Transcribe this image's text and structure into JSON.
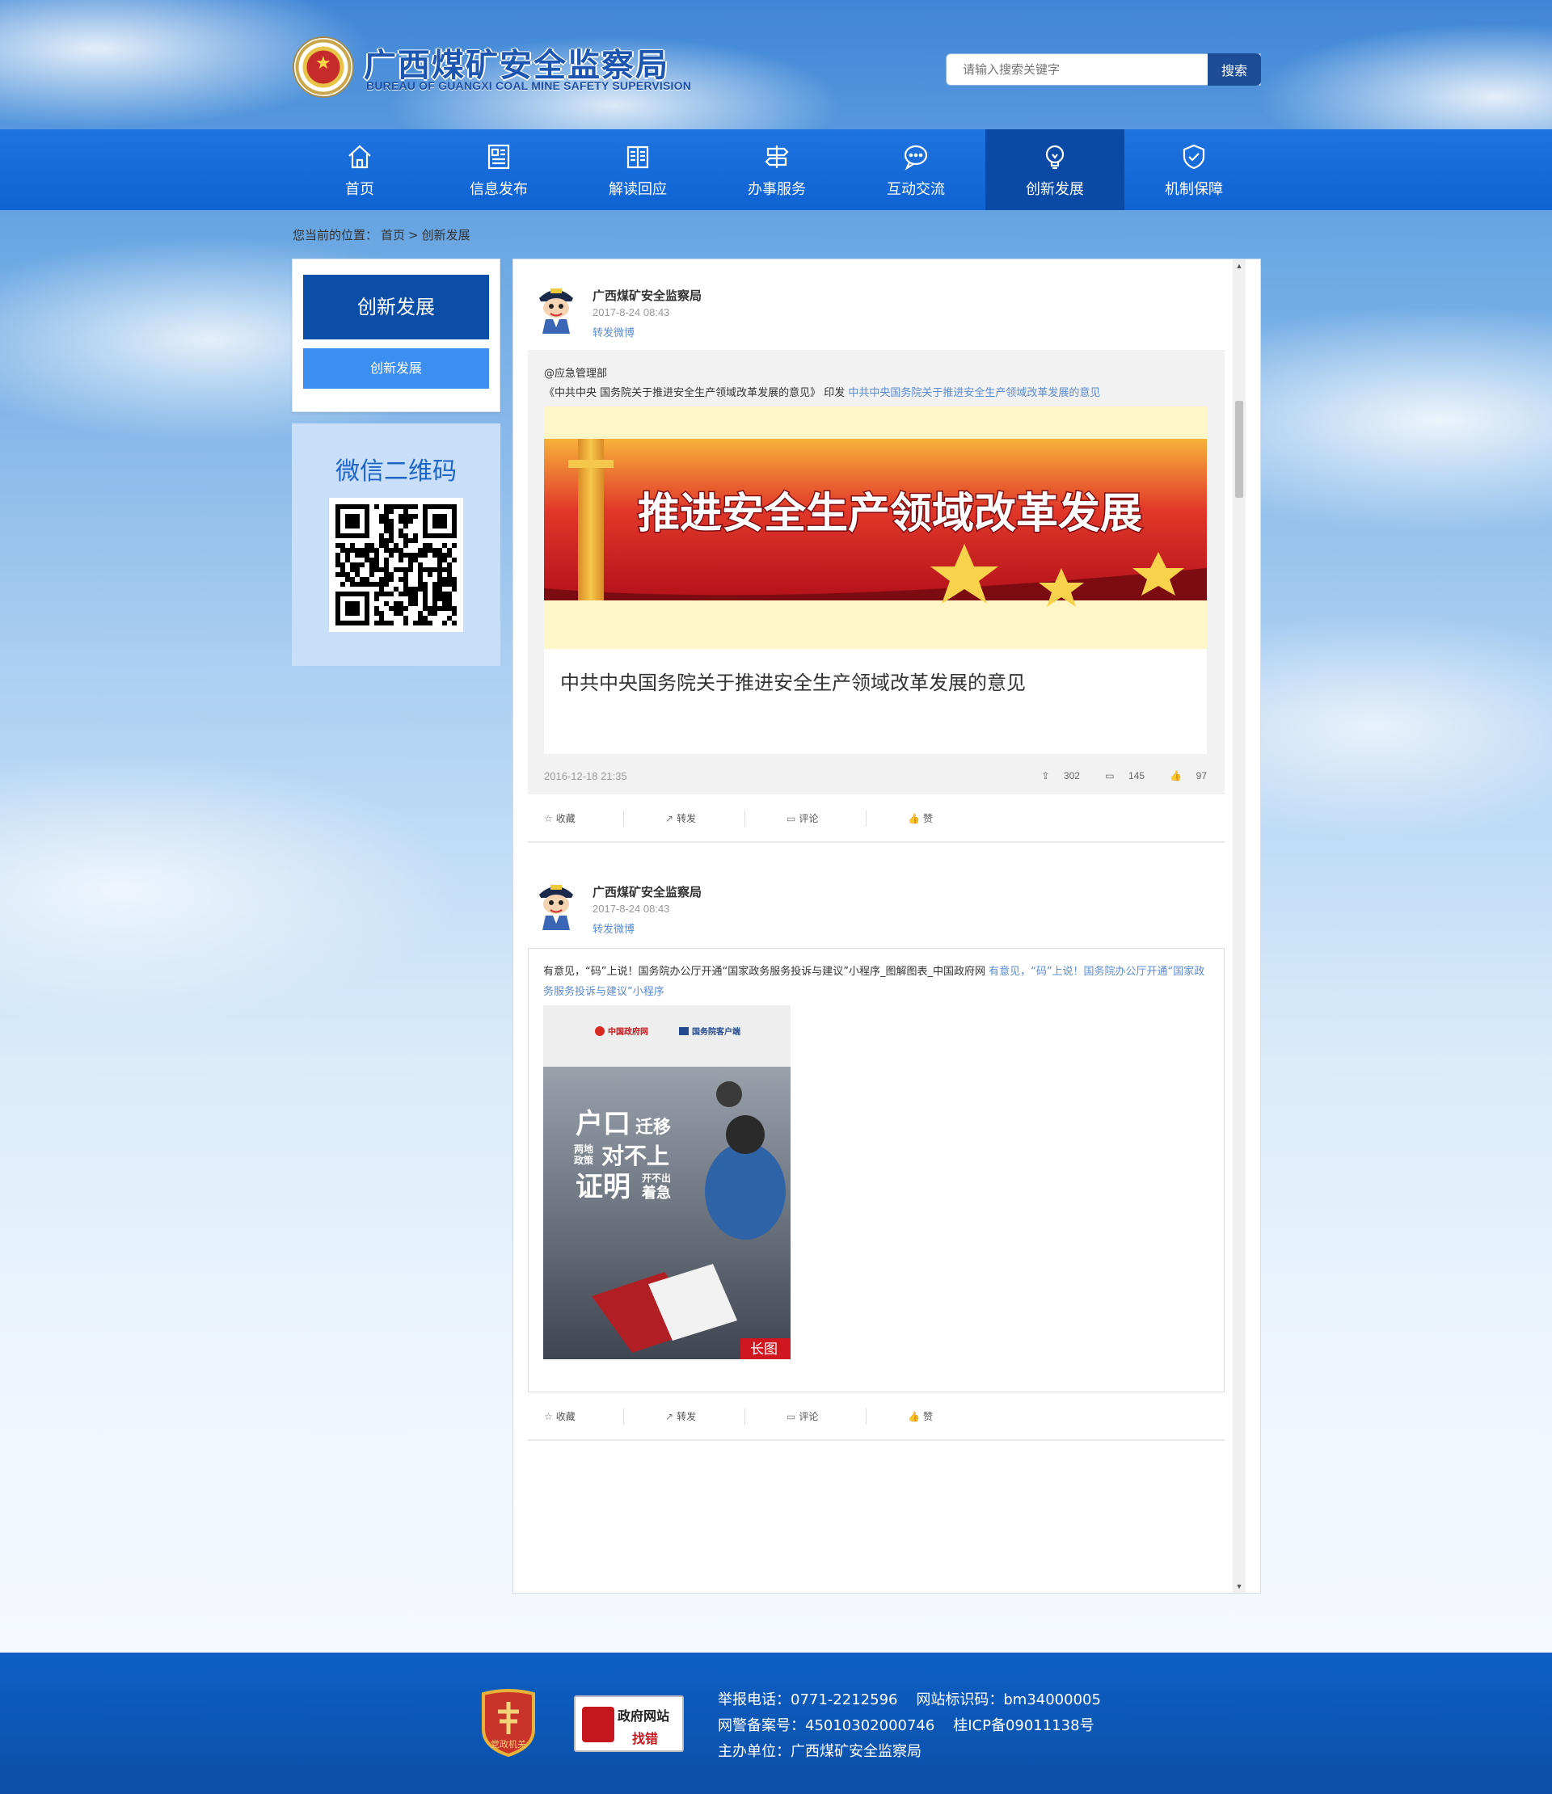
{
  "header": {
    "title": "广西煤矿安全监察局",
    "subtitle": "BUREAU OF GUANGXI COAL MINE SAFETY SUPERVISION",
    "search_placeholder": "请输入搜索关键字",
    "search_button": "搜索"
  },
  "nav": {
    "items": [
      {
        "label": "首页",
        "icon": "home-icon"
      },
      {
        "label": "信息发布",
        "icon": "newspaper-icon"
      },
      {
        "label": "解读回应",
        "icon": "book-icon"
      },
      {
        "label": "办事服务",
        "icon": "signpost-icon"
      },
      {
        "label": "互动交流",
        "icon": "chat-icon"
      },
      {
        "label": "创新发展",
        "icon": "lightbulb-icon",
        "active": true
      },
      {
        "label": "机制保障",
        "icon": "shield-check-icon"
      }
    ]
  },
  "breadcrumb": {
    "prefix": "您当前的位置：",
    "home": "首页",
    "separator": ">",
    "current": "创新发展"
  },
  "sidebar": {
    "heading": "创新发展",
    "item": "创新发展",
    "wechat_title": "微信二维码"
  },
  "posts": [
    {
      "author": "广西煤矿安全监察局",
      "date": "2017-8-24 08:43",
      "source": "转发微博",
      "repost": {
        "author": "@应急管理部",
        "text": "《中共中央  国务院关于推进安全生产领域改革发展的意见》 印发 ",
        "link": "中共中央国务院关于推进安全生产领域改革发展的意见",
        "banner_text": "推进安全生产领域改革发展",
        "card_title": "中共中央国务院关于推进安全生产领域改革发展的意见",
        "date": "2016-12-18 21:35",
        "reposts": "302",
        "comments": "145",
        "likes": "97"
      },
      "actions": {
        "favorite": "收藏",
        "forward": "转发",
        "comment": "评论",
        "like": "赞"
      }
    },
    {
      "author": "广西煤矿安全监察局",
      "date": "2017-8-24 08:43",
      "source": "转发微博",
      "text": "有意见，“码”上说！国务院办公厅开通“国家政务服务投诉与建议”小程序_图解图表_中国政府网 ",
      "link": "有意见，“码”上说！国务院办公厅开通“国家政务服务投诉与建议”小程序",
      "image": {
        "logo_left": "中国政府网",
        "logo_right": "国务院客户端",
        "line1a": "户口",
        "line1b": "迁移",
        "line2a": "两地",
        "line2b": "政策",
        "line2c": "对不上",
        "line3a": "证明",
        "line3b": "开不出",
        "line3c": "着急",
        "tag": "长图"
      },
      "actions": {
        "favorite": "收藏",
        "forward": "转发",
        "comment": "评论",
        "like": "赞"
      }
    }
  ],
  "footer": {
    "badge_text": "党政机关",
    "gov_line1": "政府网站",
    "gov_line2": "找错",
    "line1": "举报电话：0771-2212596    网站标识码：bm34000005",
    "line2": "网警备案号：45010302000746    桂ICP备09011138号",
    "line3": "主办单位：广西煤矿安全监察局"
  },
  "colors": {
    "nav_bg": "#1f74e0",
    "nav_active": "#0a4aa6",
    "sidebar_head": "#0b4ea8",
    "sidebar_item": "#3c8ef0",
    "link": "#5b8bd0",
    "footer_bg": "#0b55b8"
  }
}
